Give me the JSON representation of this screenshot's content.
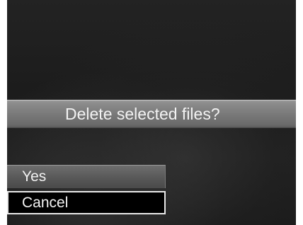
{
  "dialog": {
    "message": "Delete selected files?"
  },
  "menu": {
    "items": [
      {
        "label": "Yes",
        "selected": false
      },
      {
        "label": "Cancel",
        "selected": true
      }
    ]
  },
  "colors": {
    "background": "#1e1e1e",
    "bar": "#7c7c7c",
    "selected_fill": "#000000",
    "selected_border": "#e8e8e8",
    "text": "#f2f2f2"
  }
}
